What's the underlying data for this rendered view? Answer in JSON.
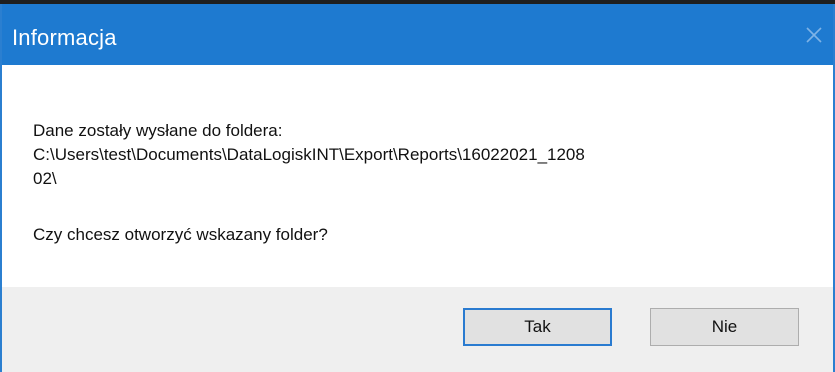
{
  "dialog": {
    "title": "Informacja",
    "message": {
      "line1": "Dane zostały wysłane do foldera:",
      "line2": "C:\\Users\\test\\Documents\\DataLogiskINT\\Export\\Reports\\16022021_1208",
      "line3": "02\\",
      "question": "Czy chcesz otworzyć wskazany folder?"
    },
    "buttons": {
      "yes_label": "Tak",
      "no_label": "Nie"
    },
    "icons": {
      "close": "close-icon"
    },
    "colors": {
      "titlebar": "#1e7ad0",
      "border": "#2b7fd0",
      "footer": "#efefef",
      "button_default_border": "#2a7bd0"
    }
  }
}
